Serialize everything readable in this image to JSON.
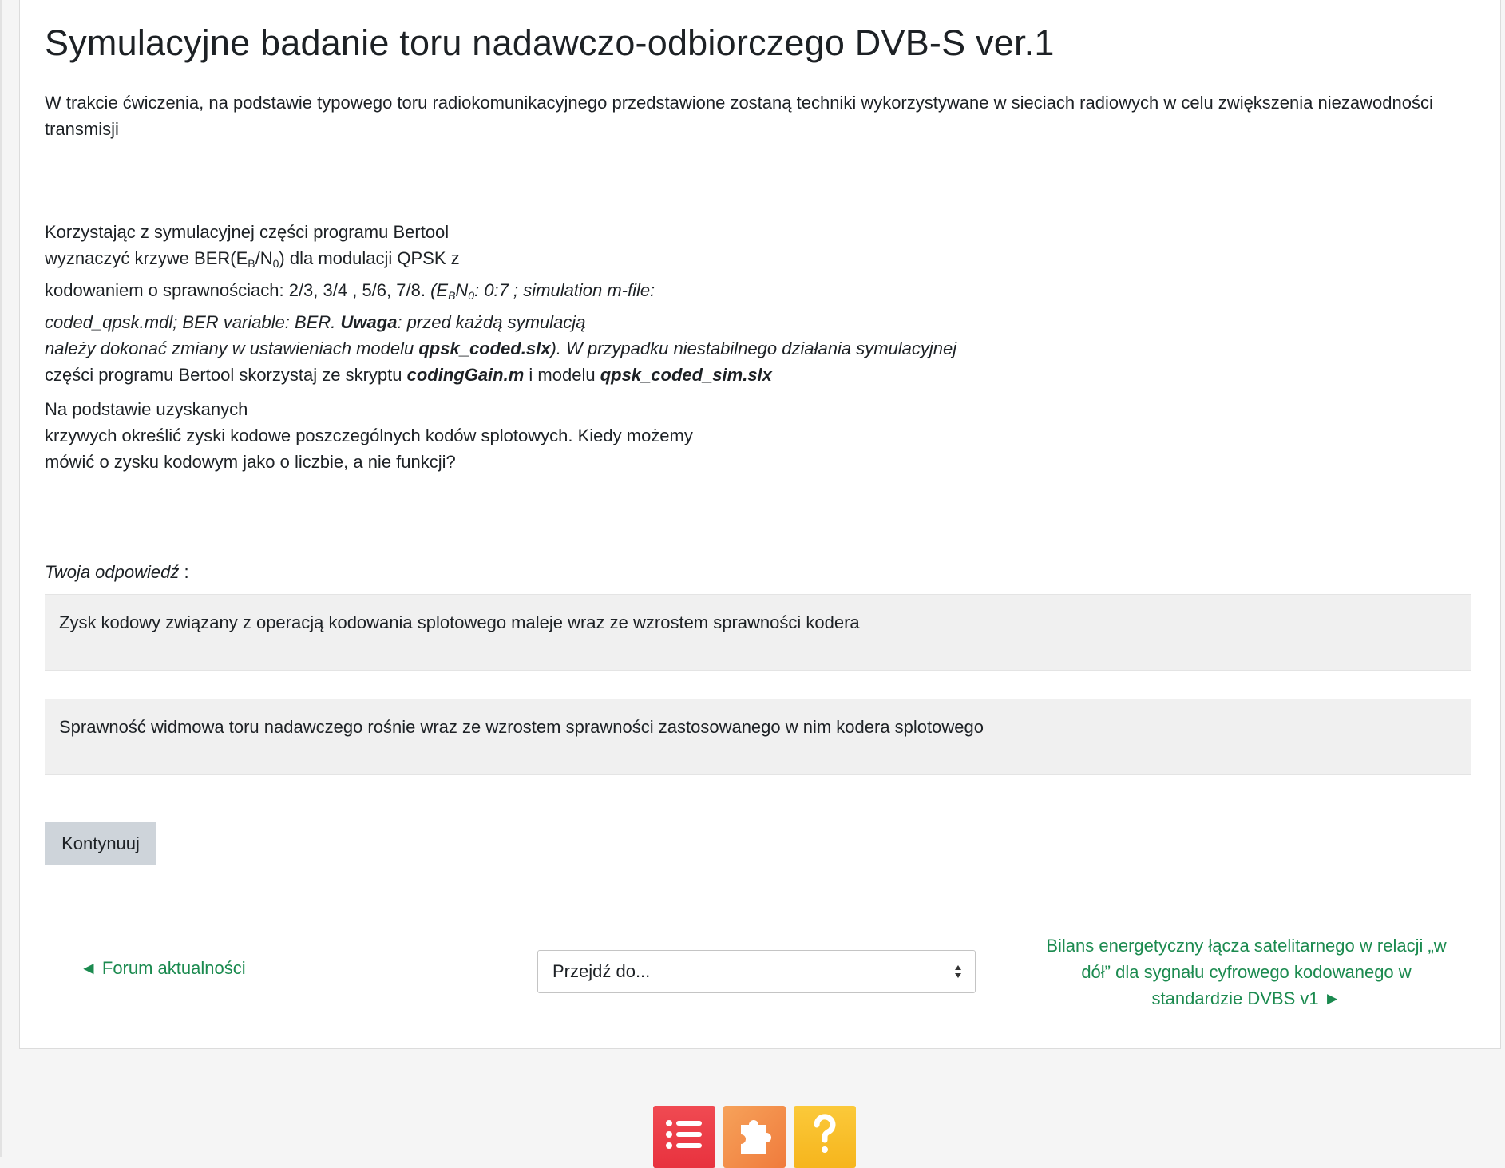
{
  "page": {
    "title": "Symulacyjne badanie toru nadawczo-odbiorczego DVB-S ver.1",
    "intro": "W trakcie ćwiczenia, na podstawie typowego toru radiokomunikacyjnego przedstawione zostaną techniki wykorzystywane w sieciach radiowych w celu zwiększenia niezawodności transmisji"
  },
  "task": {
    "l1": "Korzystając z symulacyjnej części programu Bertool",
    "l2_a": "wyznaczyć krzywe BER(E",
    "l2_sub1": "B",
    "l2_b": "/N",
    "l2_sub2": "0",
    "l2_c": ") dla modulacji QPSK z",
    "l3_a": "kodowaniem o sprawnościach: 2/3, 3/4 , 5/6, 7/8. ",
    "l3_i1": "(E",
    "l3_sub1": "B",
    "l3_i2": "N",
    "l3_sub2": "0",
    "l3_i3": ": 0:7 ; simulation m-file:",
    "l4_a": "coded_qpsk.mdl; BER variable: BER. ",
    "l4_b": "Uwaga",
    "l4_c": ": przed każdą symulacją",
    "l5_a": "należy dokonać zmiany w ustawieniach modelu ",
    "l5_b": "qpsk_coded.slx",
    "l5_c": "). W przypadku niestabilnego działania symulacyjnej",
    "l6_a": "części programu Bertool skorzystaj ze skryptu ",
    "l6_b": "codingGain.m",
    "l6_c": " i modelu ",
    "l6_d": "qpsk_coded_sim.slx"
  },
  "question": {
    "l1": "Na podstawie uzyskanych",
    "l2": "krzywych określić zyski kodowe poszczególnych kodów splotowych. Kiedy możemy",
    "l3": "mówić o zysku kodowym jako o liczbie, a nie funkcji?"
  },
  "answer": {
    "label": "Twoja odpowiedź",
    "label_suffix": " :",
    "items": [
      "Zysk kodowy związany z operacją kodowania splotowego maleje wraz ze wzrostem sprawności kodera",
      "Sprawność widmowa toru nadawczego rośnie wraz ze wzrostem sprawności zastosowanego w nim kodera splotowego"
    ]
  },
  "buttons": {
    "continue": "Kontynuuj"
  },
  "navigation": {
    "prev": "◄ Forum aktualności",
    "jump_placeholder": "Przejdź do...",
    "next_l1": "Bilans energetyczny łącza satelitarnego w relacji „w",
    "next_l2": "dół” dla sygnału cyfrowego kodowanego w",
    "next_l3": "standardzie DVBS v1 ►"
  },
  "colors": {
    "link": "#1b8a4f",
    "button_bg": "#ced4da",
    "answer_bg": "#f0f0f0"
  },
  "icons": [
    "list-icon",
    "puzzle-icon",
    "help-icon"
  ]
}
